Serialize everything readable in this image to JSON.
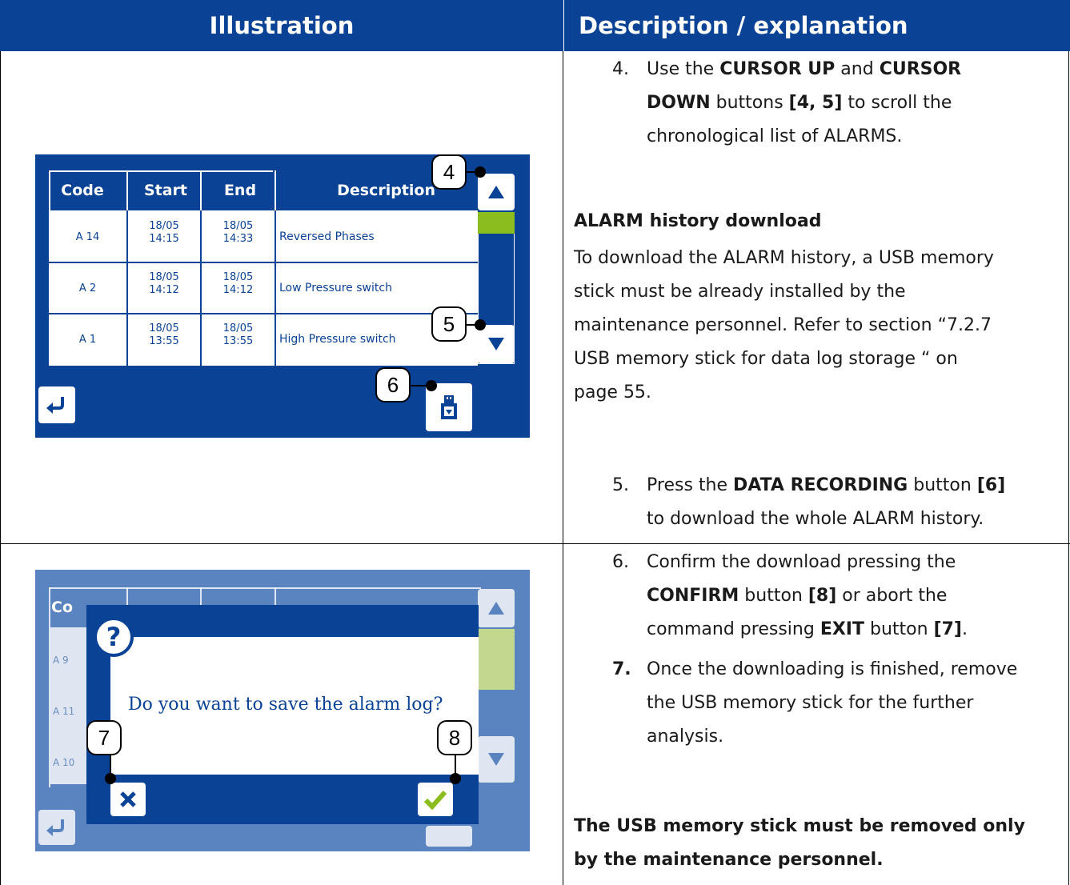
{
  "header": {
    "illustration": "Illustration",
    "description": "Description / explanation"
  },
  "row1": {
    "step4_num": "4.",
    "step4_line1_a": "Use the ",
    "step4_line1_b": "CURSOR UP",
    "step4_line1_c": " and ",
    "step4_line1_d": "CURSOR",
    "step4_line2_a": "DOWN",
    "step4_line2_b": " buttons ",
    "step4_line2_c": "[4, 5]",
    "step4_line2_d": " to scroll the",
    "step4_line3": "chronological list of ALARMS.",
    "section_title": "ALARM history download",
    "para_line1": "To download the ALARM history, a USB memory",
    "para_line2": "stick must be already installed by the",
    "para_line3": "maintenance personnel. Refer to section “7.2.7",
    "para_line4": "USB memory stick for data log storage “ on",
    "para_line5": "page 55.",
    "step5_num": "5.",
    "step5_line1_a": "Press the ",
    "step5_line1_b": "DATA RECORDING",
    "step5_line1_c": " button ",
    "step5_line1_d": "[6]",
    "step5_line2": "to download the whole ALARM history."
  },
  "screen1": {
    "columns": [
      "Code",
      "Start",
      "End",
      "Description"
    ],
    "rows": [
      {
        "code": "A 14",
        "start_date": "18/05",
        "start_time": "14:15",
        "end_date": "18/05",
        "end_time": "14:33",
        "description": "Reversed Phases"
      },
      {
        "code": "A 2",
        "start_date": "18/05",
        "start_time": "14:12",
        "end_date": "18/05",
        "end_time": "14:12",
        "description": "Low Pressure switch"
      },
      {
        "code": "A 1",
        "start_date": "18/05",
        "start_time": "13:55",
        "end_date": "18/05",
        "end_time": "13:55",
        "description": "High Pressure switch"
      }
    ],
    "callout_4": "4",
    "callout_5": "5",
    "callout_6": "6"
  },
  "screen2": {
    "bg_code_a": "Co",
    "bg_row_1": "A 9",
    "bg_row_2": "A 11",
    "bg_row_3": "A 10",
    "dialog_question": "Do you want to save the alarm log?",
    "callout_7": "7",
    "callout_8": "8"
  },
  "row2": {
    "step6_num": "6.",
    "step6_line1": "Confirm the download pressing the",
    "step6_line2_a": "CONFIRM",
    "step6_line2_b": " button ",
    "step6_line2_c": "[8]",
    "step6_line2_d": " or abort the",
    "step6_line3_a": "command pressing ",
    "step6_line3_b": "EXIT",
    "step6_line3_c": " button ",
    "step6_line3_d": "[7]",
    "step6_line3_e": ".",
    "step7_num": "7.",
    "step7_line1": "Once the downloading is finished, remove",
    "step7_line2": "the USB memory stick for the further",
    "step7_line3": "analysis.",
    "warning_line1": "The USB memory stick must be removed only",
    "warning_line2": "by the maintenance personnel."
  },
  "colors": {
    "brand_blue": "#0a4295",
    "dim_blue": "#5a84c0",
    "accent_green": "#8cbd1f"
  }
}
